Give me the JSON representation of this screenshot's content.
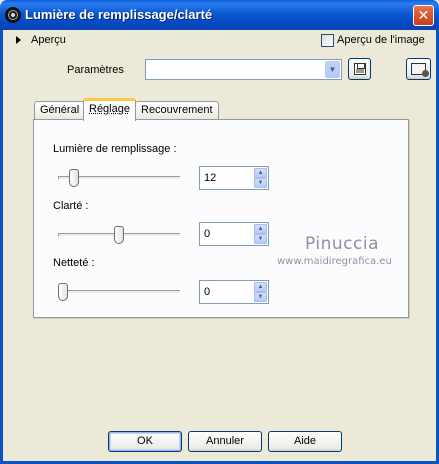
{
  "window": {
    "title": "Lumière de remplissage/clarté",
    "close_glyph": "✕"
  },
  "preview": {
    "label": "Aperçu",
    "checkbox_label": "Aperçu de l'image",
    "checked": false
  },
  "params": {
    "label": "Paramètres",
    "value": ""
  },
  "tabs": [
    {
      "label": "Général",
      "active": false
    },
    {
      "label": "Réglage",
      "active": true
    },
    {
      "label": "Recouvrement",
      "active": false
    }
  ],
  "fields": {
    "fill_light": {
      "label": "Lumière de remplissage :",
      "value": "12"
    },
    "clarity": {
      "label": "Clarté :",
      "value": "0"
    },
    "sharpness": {
      "label": "Netteté :",
      "value": "0"
    }
  },
  "watermark": {
    "name": "Pinuccia",
    "url": "www.maidiregrafica.eu"
  },
  "buttons": {
    "ok": "OK",
    "cancel": "Annuler",
    "help": "Aide"
  }
}
